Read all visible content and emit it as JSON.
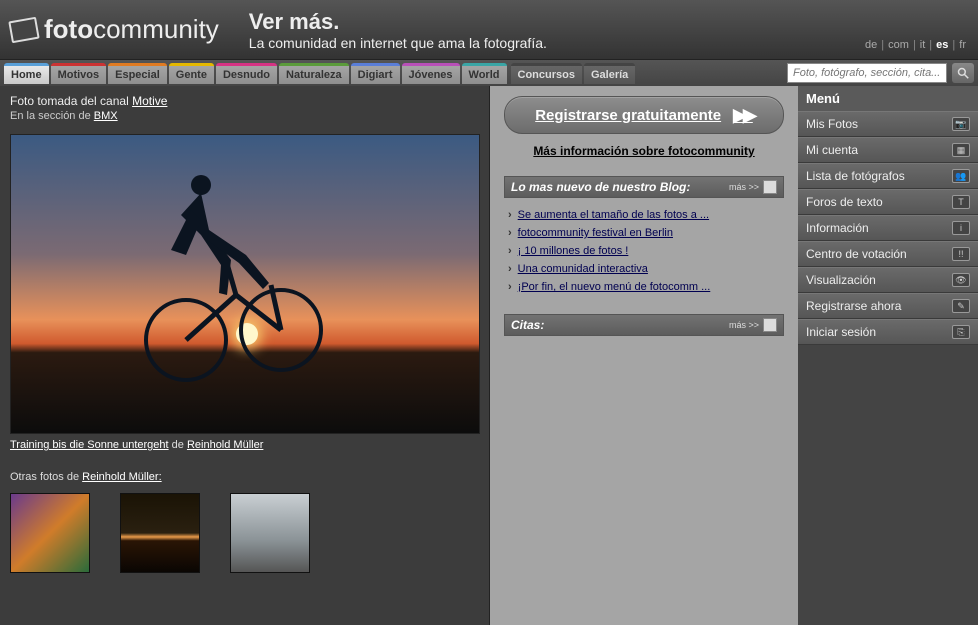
{
  "header": {
    "logo_a": "foto",
    "logo_b": "community",
    "tag_big": "Ver más.",
    "tag_sub": "La comunidad en internet que ama la fotografía."
  },
  "langs": [
    "de",
    "com",
    "it",
    "es",
    "fr"
  ],
  "lang_selected": "es",
  "nav": {
    "tabs": [
      "Home",
      "Motivos",
      "Especial",
      "Gente",
      "Desnudo",
      "Naturaleza",
      "Digiart",
      "Jóvenes",
      "World"
    ],
    "dark": [
      "Concursos",
      "Galería"
    ],
    "search_placeholder": "Foto, fotógrafo, sección, cita..."
  },
  "featured": {
    "crumb_prefix": "Foto tomada del canal ",
    "crumb_link": "Motive",
    "section_prefix": "En la sección de ",
    "section_link": "BMX",
    "caption_title": "Training bis die Sonne untergeht",
    "caption_by": " de ",
    "caption_author": "Reinhold Müller",
    "more_prefix": "Otras fotos de ",
    "more_author": "Reinhold Müller:"
  },
  "register": {
    "label": "Registrarse gratuitamente",
    "more_info": "Más información sobre fotocommunity"
  },
  "blog": {
    "title": "Lo mas nuevo de nuestro Blog:",
    "mas": "más >>",
    "items": [
      "Se aumenta el tamaño de las fotos a ...",
      "fotocommunity festival en Berlin",
      "¡ 10 millones de fotos !",
      "Una comunidad interactiva",
      "¡Por fin, el nuevo menú de fotocomm ..."
    ]
  },
  "citas": {
    "title": "Citas:",
    "mas": "más >>"
  },
  "sidebar": {
    "title": "Menú",
    "items": [
      {
        "label": "Mis Fotos",
        "icon": "📷"
      },
      {
        "label": "Mi cuenta",
        "icon": "▦"
      },
      {
        "label": "Lista de fotógrafos",
        "icon": "👥"
      },
      {
        "label": "Foros de texto",
        "icon": "T"
      },
      {
        "label": "Información",
        "icon": "i"
      },
      {
        "label": "Centro de votación",
        "icon": "!!"
      },
      {
        "label": "Visualización",
        "icon": "👁"
      },
      {
        "label": "Registrarse ahora",
        "icon": "✎"
      },
      {
        "label": "Iniciar sesión",
        "icon": "⎘"
      }
    ]
  }
}
